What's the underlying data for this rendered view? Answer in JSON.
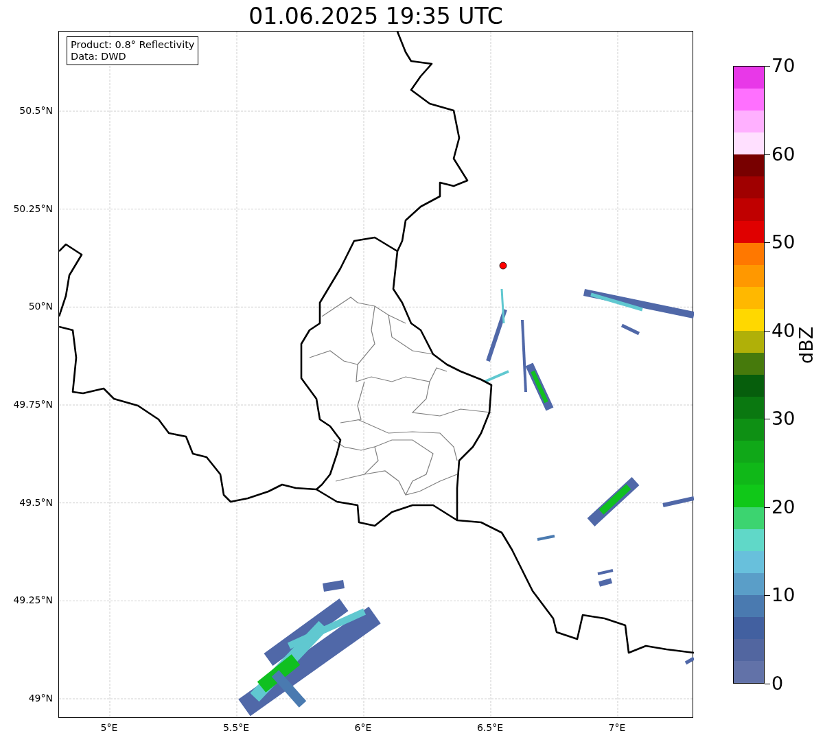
{
  "title": "01.06.2025 19:35 UTC",
  "info_box": {
    "lines": [
      "Product: 0.8° Reflectivity",
      "Data: DWD"
    ]
  },
  "map": {
    "y_ticks": [
      "50.5°N",
      "50.25°N",
      "50°N",
      "49.75°N",
      "49.5°N",
      "49.25°N",
      "49°N"
    ],
    "x_ticks": [
      "5°E",
      "5.5°E",
      "6°E",
      "6.5°E",
      "7°E"
    ]
  },
  "colorbar": {
    "label": "dBZ",
    "ticks": [
      "70",
      "60",
      "50",
      "40",
      "30",
      "20",
      "10",
      "0"
    ],
    "bands": [
      {
        "color": "#e838e8"
      },
      {
        "color": "#ff70ff"
      },
      {
        "color": "#ffb0ff"
      },
      {
        "color": "#ffe0ff"
      },
      {
        "color": "#780000"
      },
      {
        "color": "#a00000"
      },
      {
        "color": "#c00000"
      },
      {
        "color": "#e00000"
      },
      {
        "color": "#ff7800"
      },
      {
        "color": "#ff9800"
      },
      {
        "color": "#ffb800"
      },
      {
        "color": "#ffd800"
      },
      {
        "color": "#b0b008"
      },
      {
        "color": "#467a0c"
      },
      {
        "color": "#065e0c"
      },
      {
        "color": "#0a7810"
      },
      {
        "color": "#0e9014"
      },
      {
        "color": "#10a818"
      },
      {
        "color": "#10b818"
      },
      {
        "color": "#10c818"
      },
      {
        "color": "#3cd470"
      },
      {
        "color": "#60d8c8"
      },
      {
        "color": "#68c0dc"
      },
      {
        "color": "#5a9ec8"
      },
      {
        "color": "#4a7ab0"
      },
      {
        "color": "#4260a0"
      },
      {
        "color": "#5266a0"
      },
      {
        "color": "#6272a8"
      }
    ]
  }
}
